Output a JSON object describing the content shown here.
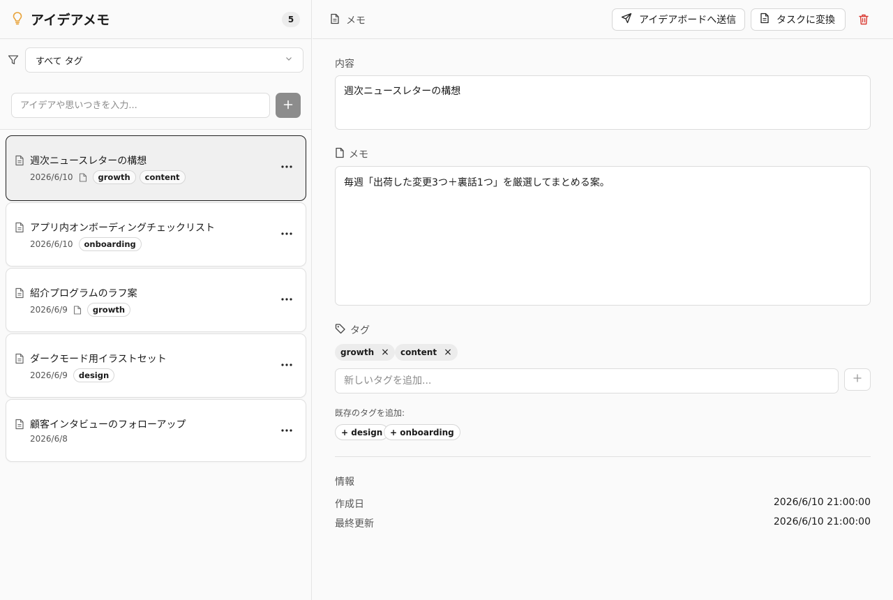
{
  "app": {
    "title": "アイデアメモ",
    "count": "5"
  },
  "filter": {
    "value": "すべて タグ"
  },
  "new_idea": {
    "placeholder": "アイデアや思いつきを入力..."
  },
  "ideas": [
    {
      "title": "週次ニュースレターの構想",
      "date": "2026/6/10",
      "has_memo": true,
      "tags": [
        "growth",
        "content"
      ],
      "selected": true
    },
    {
      "title": "アプリ内オンボーディングチェックリスト",
      "date": "2026/6/10",
      "has_memo": false,
      "tags": [
        "onboarding"
      ],
      "selected": false
    },
    {
      "title": "紹介プログラムのラフ案",
      "date": "2026/6/9",
      "has_memo": true,
      "tags": [
        "growth"
      ],
      "selected": false
    },
    {
      "title": "ダークモード用イラストセット",
      "date": "2026/6/9",
      "has_memo": false,
      "tags": [
        "design"
      ],
      "selected": false
    },
    {
      "title": "顧客インタビューのフォローアップ",
      "date": "2026/6/8",
      "has_memo": false,
      "tags": [],
      "selected": false
    }
  ],
  "detail": {
    "header_label": "メモ",
    "send_button": "アイデアボードへ送信",
    "convert_button": "タスクに変換",
    "content_label": "内容",
    "content_value": "週次ニュースレターの構想",
    "memo_label": "メモ",
    "memo_value": "毎週「出荷した変更3つ＋裏話1つ」を厳選してまとめる案。",
    "tags_label": "タグ",
    "tags": [
      "growth",
      "content"
    ],
    "tag_input_placeholder": "新しいタグを追加...",
    "existing_tags_label": "既存のタグを追加:",
    "existing_tags": [
      "+ design",
      "+ onboarding"
    ],
    "info_title": "情報",
    "created_label": "作成日",
    "created_value": "2026/6/10 21:00:00",
    "updated_label": "最終更新",
    "updated_value": "2026/6/10 21:00:00"
  },
  "colors": {
    "accent_bulb": "#e8a33a",
    "trash": "#d93a32",
    "add_button": "#8c8c8c"
  }
}
